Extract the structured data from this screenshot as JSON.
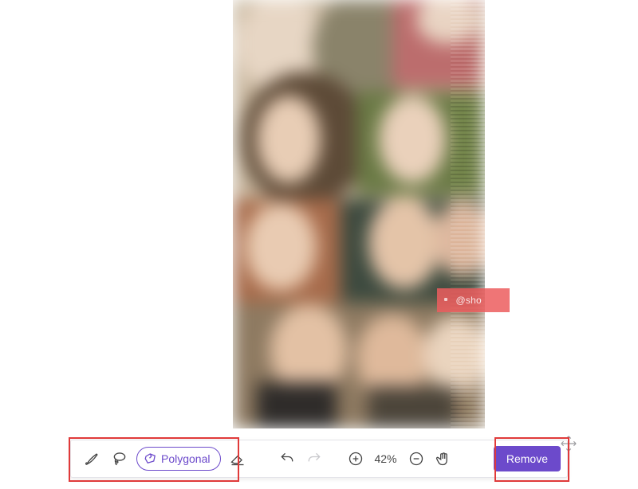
{
  "toolbar": {
    "brush_tool": "brush",
    "lasso_tool": "lasso",
    "polygonal_tool_label": "Polygonal",
    "eraser_tool": "eraser",
    "undo": "undo",
    "redo": "redo",
    "zoom_in": "zoom-in",
    "zoom_level": "42%",
    "zoom_out": "zoom-out",
    "pan": "pan",
    "remove_label": "Remove"
  },
  "watermark_text": "@sho"
}
